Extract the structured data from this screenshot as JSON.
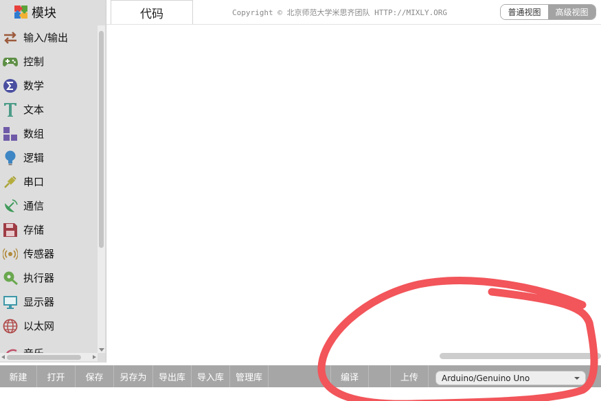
{
  "sidebar": {
    "header": {
      "label": "模块",
      "icon": "puzzle-icon"
    },
    "items": [
      {
        "label": "输入/输出",
        "icon": "io-arrows-icon"
      },
      {
        "label": "控制",
        "icon": "gamepad-icon"
      },
      {
        "label": "数学",
        "icon": "math-sigma-icon"
      },
      {
        "label": "文本",
        "icon": "text-t-icon"
      },
      {
        "label": "数组",
        "icon": "array-blocks-icon"
      },
      {
        "label": "逻辑",
        "icon": "lightbulb-icon"
      },
      {
        "label": "串口",
        "icon": "usb-plug-icon"
      },
      {
        "label": "通信",
        "icon": "satellite-dish-icon"
      },
      {
        "label": "存储",
        "icon": "floppy-disk-icon"
      },
      {
        "label": "传感器",
        "icon": "sensor-icon"
      },
      {
        "label": "执行器",
        "icon": "actuator-icon"
      },
      {
        "label": "显示器",
        "icon": "monitor-icon"
      },
      {
        "label": "以太网",
        "icon": "globe-icon"
      },
      {
        "label": "音乐",
        "icon": "music-icon"
      }
    ]
  },
  "tabs": {
    "code_label": "代码"
  },
  "header": {
    "copyright": "Copyright © 北京师范大学米思齐团队 HTTP://MIXLY.ORG",
    "view_normal": "普通视图",
    "view_advanced": "高级视图"
  },
  "toolbar": {
    "new": "新建",
    "open": "打开",
    "save": "保存",
    "save_as": "另存为",
    "export_lib": "导出库",
    "import_lib": "导入库",
    "manage_lib": "管理库",
    "compile": "编译",
    "upload": "上传",
    "board": "Arduino/Genuino Uno"
  },
  "colors": {
    "sidebar_bg": "#dddddd",
    "toolbar_bg": "#a6a6a6",
    "annotation": "#f2555a"
  }
}
